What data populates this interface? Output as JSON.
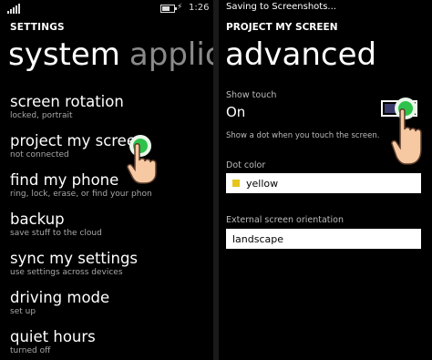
{
  "left_screen": {
    "status": {
      "time": "1:26",
      "charging_icon": "plug-icon",
      "battery_level": 0.7
    },
    "header": "SETTINGS",
    "pivot": {
      "active": "system",
      "inactive": "applica"
    },
    "menu": [
      {
        "title": "screen rotation",
        "subtitle": "locked, portrait"
      },
      {
        "title": "project my scree",
        "subtitle": "not connected"
      },
      {
        "title": "find my phone",
        "subtitle": "ring, lock, erase, or find your phon"
      },
      {
        "title": "backup",
        "subtitle": "save stuff to the cloud"
      },
      {
        "title": "sync my settings",
        "subtitle": "use settings across devices"
      },
      {
        "title": "driving mode",
        "subtitle": "set up"
      },
      {
        "title": "quiet hours",
        "subtitle": "turned off"
      }
    ]
  },
  "right_screen": {
    "toast": "Saving to Screenshots...",
    "header": "PROJECT MY SCREEN",
    "title": "advanced",
    "show_touch": {
      "label": "Show touch",
      "value": "On",
      "on": true,
      "help": "Show a dot when you touch the screen."
    },
    "dot_color": {
      "label": "Dot color",
      "value": "yellow",
      "swatch": "#e6c619"
    },
    "orientation": {
      "label": "External screen orientation",
      "value": "landscape"
    }
  },
  "colors": {
    "touch_dot": "#2ec24a",
    "hand_skin": "#f6c9a3"
  }
}
